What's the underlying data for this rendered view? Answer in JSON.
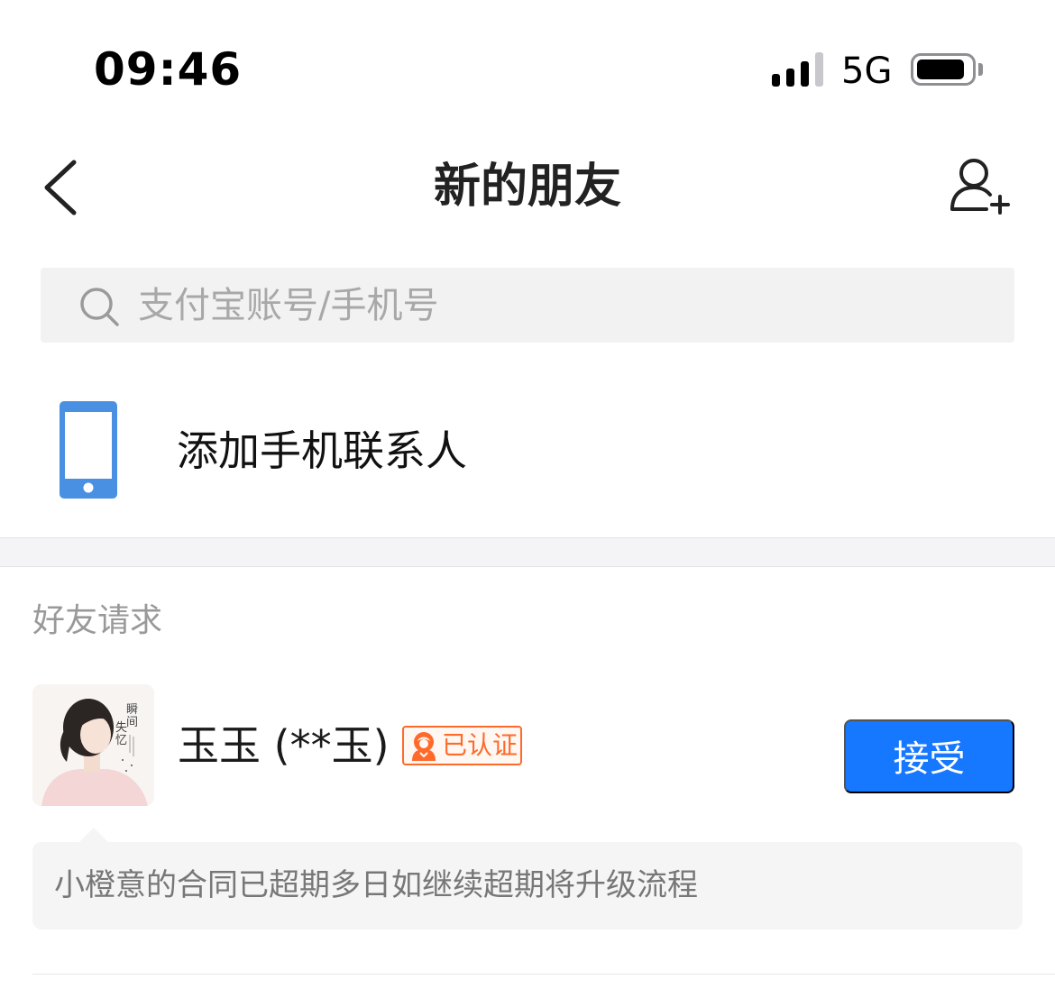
{
  "status_bar": {
    "time": "09:46",
    "network": "5G",
    "signal_icon": "signal-bars-icon",
    "battery_icon": "battery-icon"
  },
  "nav": {
    "title": "新的朋友",
    "back_icon": "chevron-left-icon",
    "add_friend_icon": "add-user-icon"
  },
  "search": {
    "placeholder": "支付宝账号/手机号",
    "value": "",
    "icon": "search-icon"
  },
  "contacts_entry": {
    "label": "添加手机联系人",
    "icon": "phone-icon",
    "icon_color": "#4a90e2"
  },
  "friend_requests": {
    "section_label": "好友请求",
    "items": [
      {
        "name": "玉玉 (**玉)",
        "badge": "已认证",
        "badge_icon": "verified-person-icon",
        "accept_label": "接受",
        "message": "小橙意的合同已超期多日如继续超期将升级流程",
        "avatar_icon": "avatar-photo"
      }
    ]
  },
  "colors": {
    "accent": "#1677ff",
    "badge": "#ff6a2b",
    "muted_text": "#999999",
    "search_bg": "#f2f2f2"
  }
}
